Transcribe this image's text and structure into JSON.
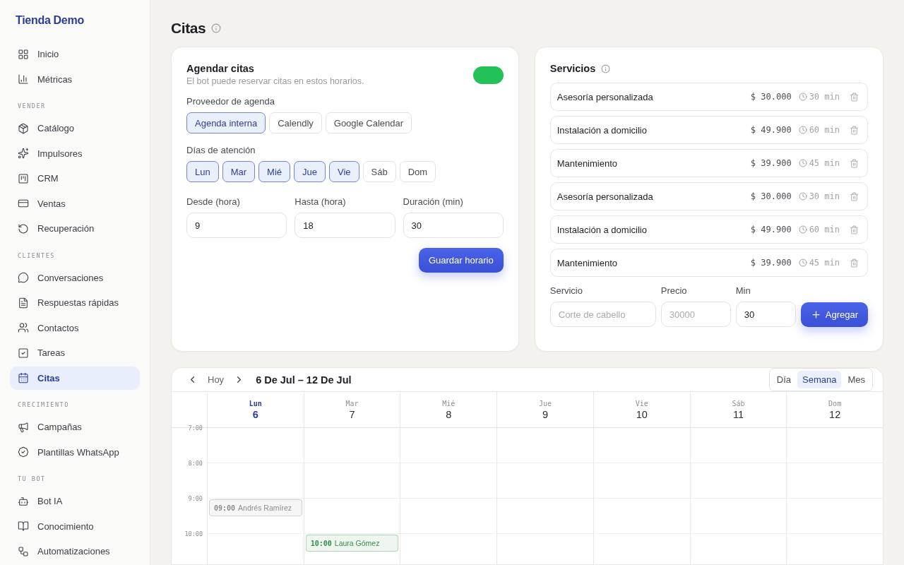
{
  "sidebar": {
    "brand": "Tienda Demo",
    "sections": [
      {
        "items": [
          {
            "label": "Inicio",
            "selected": false
          },
          {
            "label": "Métricas",
            "selected": false
          }
        ]
      },
      {
        "title": "VENDER",
        "items": [
          {
            "label": "Catálogo",
            "selected": false
          },
          {
            "label": "Impulsores",
            "selected": false
          },
          {
            "label": "CRM",
            "selected": false
          },
          {
            "label": "Ventas",
            "selected": false
          },
          {
            "label": "Recuperación",
            "selected": false
          }
        ]
      },
      {
        "title": "CLIENTES",
        "items": [
          {
            "label": "Conversaciones",
            "selected": false
          },
          {
            "label": "Respuestas rápidas",
            "selected": false
          },
          {
            "label": "Contactos",
            "selected": false
          },
          {
            "label": "Tareas",
            "selected": false
          },
          {
            "label": "Citas",
            "selected": true
          }
        ]
      },
      {
        "title": "CRECIMIENTO",
        "items": [
          {
            "label": "Campañas",
            "selected": false
          },
          {
            "label": "Plantillas WhatsApp",
            "selected": false
          }
        ]
      },
      {
        "title": "TU BOT",
        "items": [
          {
            "label": "Bot IA",
            "selected": false
          },
          {
            "label": "Conocimiento",
            "selected": false
          },
          {
            "label": "Automatizaciones",
            "selected": false
          }
        ]
      }
    ]
  },
  "page": {
    "title": "Citas"
  },
  "schedule": {
    "title": "Agendar citas",
    "subtitle": "El bot puede reservar citas en estos horarios.",
    "enabled": true,
    "provider_label": "Proveedor de agenda",
    "providers": [
      {
        "label": "Agenda interna",
        "selected": true
      },
      {
        "label": "Calendly",
        "selected": false
      },
      {
        "label": "Google Calendar",
        "selected": false
      }
    ],
    "days_label": "Días de atención",
    "days": [
      {
        "label": "Lun",
        "selected": true
      },
      {
        "label": "Mar",
        "selected": true
      },
      {
        "label": "Mié",
        "selected": true
      },
      {
        "label": "Jue",
        "selected": true
      },
      {
        "label": "Vie",
        "selected": true
      },
      {
        "label": "Sáb",
        "selected": false
      },
      {
        "label": "Dom",
        "selected": false
      }
    ],
    "fields": [
      {
        "label": "Desde (hora)",
        "value": "9"
      },
      {
        "label": "Hasta (hora)",
        "value": "18"
      },
      {
        "label": "Duración (min)",
        "value": "30"
      }
    ],
    "save_button": "Guardar horario"
  },
  "services": {
    "title": "Servicios",
    "items": [
      {
        "name": "Asesoría personalizada",
        "price": "$ 30.000",
        "duration": "30 min"
      },
      {
        "name": "Instalación a domicilio",
        "price": "$ 49.900",
        "duration": "60 min"
      },
      {
        "name": "Mantenimiento",
        "price": "$ 39.900",
        "duration": "45 min"
      },
      {
        "name": "Asesoría personalizada",
        "price": "$ 30.000",
        "duration": "30 min"
      },
      {
        "name": "Instalación a domicilio",
        "price": "$ 49.900",
        "duration": "60 min"
      },
      {
        "name": "Mantenimiento",
        "price": "$ 39.900",
        "duration": "45 min"
      }
    ],
    "form": [
      {
        "label": "Servicio",
        "placeholder": "Corte de cabello"
      },
      {
        "label": "Precio",
        "placeholder": "30000"
      },
      {
        "label": "Min",
        "value": "30"
      }
    ],
    "add_button": "Agregar"
  },
  "calendar": {
    "today_button": "Hoy",
    "range": "6 De Jul – 12 De Jul",
    "views": [
      {
        "label": "Día",
        "selected": false
      },
      {
        "label": "Semana",
        "selected": true
      },
      {
        "label": "Mes",
        "selected": false
      }
    ],
    "days": [
      {
        "name": "Lun",
        "date": "6",
        "selected": true,
        "events": [
          {
            "time": "09:00",
            "name": "Andrés Ramírez",
            "color": "#8a8f8c"
          }
        ]
      },
      {
        "name": "Mar",
        "date": "7",
        "selected": false,
        "events": [
          {
            "time": "10:00",
            "name": "Laura Gómez",
            "color": "#2f9146"
          }
        ]
      },
      {
        "name": "Mié",
        "date": "8",
        "selected": false
      },
      {
        "name": "Jue",
        "date": "9",
        "selected": false
      },
      {
        "name": "Vie",
        "date": "10",
        "selected": false
      },
      {
        "name": "Sáb",
        "date": "11",
        "selected": false
      },
      {
        "name": "Dom",
        "date": "12",
        "selected": false
      }
    ],
    "hours": [
      "7:00",
      "8:00",
      "9:00",
      "10:00"
    ]
  }
}
